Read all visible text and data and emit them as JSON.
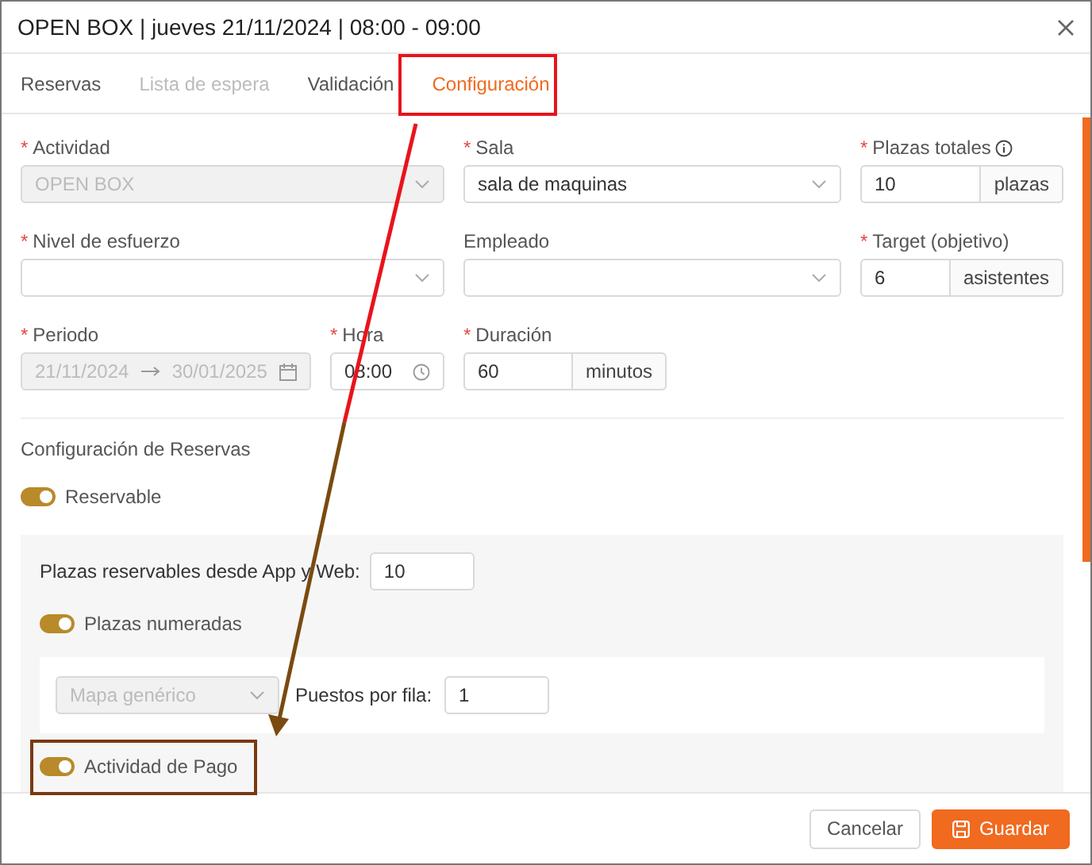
{
  "dialog": {
    "title": "OPEN BOX | jueves 21/11/2024 | 08:00 - 09:00"
  },
  "tabs": [
    {
      "label": "Reservas",
      "selected": false,
      "disabled": false
    },
    {
      "label": "Lista de espera",
      "selected": false,
      "disabled": true
    },
    {
      "label": "Validación",
      "selected": false,
      "disabled": false
    },
    {
      "label": "Configuración",
      "selected": true,
      "disabled": false
    }
  ],
  "form_rows": [
    [
      {
        "kind": "select",
        "required_mark": "*",
        "label": "Actividad",
        "value": "OPEN BOX",
        "disabled": true
      },
      {
        "kind": "select",
        "required_mark": "*",
        "label": "Sala",
        "value": "sala de maquinas",
        "disabled": false
      },
      {
        "kind": "addon",
        "required_mark": "*",
        "label": "Plazas totales",
        "info": true,
        "value": "10",
        "addon": "plazas"
      }
    ],
    [
      {
        "kind": "select",
        "required_mark": "*",
        "label": "Nivel de esfuerzo",
        "disabled": false
      },
      {
        "kind": "select",
        "label": "Empleado",
        "disabled": false
      },
      {
        "kind": "addon",
        "required_mark": "*",
        "label": "Target (objetivo)",
        "value": "6",
        "addon": "asistentes"
      }
    ],
    [
      {
        "kind": "daterange",
        "required_mark": "*",
        "label": "Periodo",
        "from": "21/11/2024",
        "to": "30/01/2025",
        "disabled": true
      },
      {
        "kind": "time",
        "required_mark": "*",
        "label": "Hora",
        "value": "08:00"
      },
      {
        "kind": "addon",
        "required_mark": "*",
        "label": "Duración",
        "value": "60",
        "addon": "minutos"
      }
    ]
  ],
  "reservas": {
    "title": "Configuración de Reservas",
    "reservable": {
      "label": "Reservable",
      "on": true
    },
    "plazas_label": "Plazas reservables desde App y Web:",
    "plazas_value": "10",
    "numeradas": {
      "label": "Plazas numeradas",
      "on": true
    },
    "mapa": {
      "value": "Mapa genérico",
      "disabled": true
    },
    "puestos_label": "Puestos por fila:",
    "puestos_value": "1",
    "pago": {
      "label": "Actividad de Pago",
      "on": true
    }
  },
  "footer_buttons": [
    {
      "label": "Cancelar",
      "kind": "secondary"
    },
    {
      "label": "Guardar",
      "kind": "primary"
    }
  ]
}
